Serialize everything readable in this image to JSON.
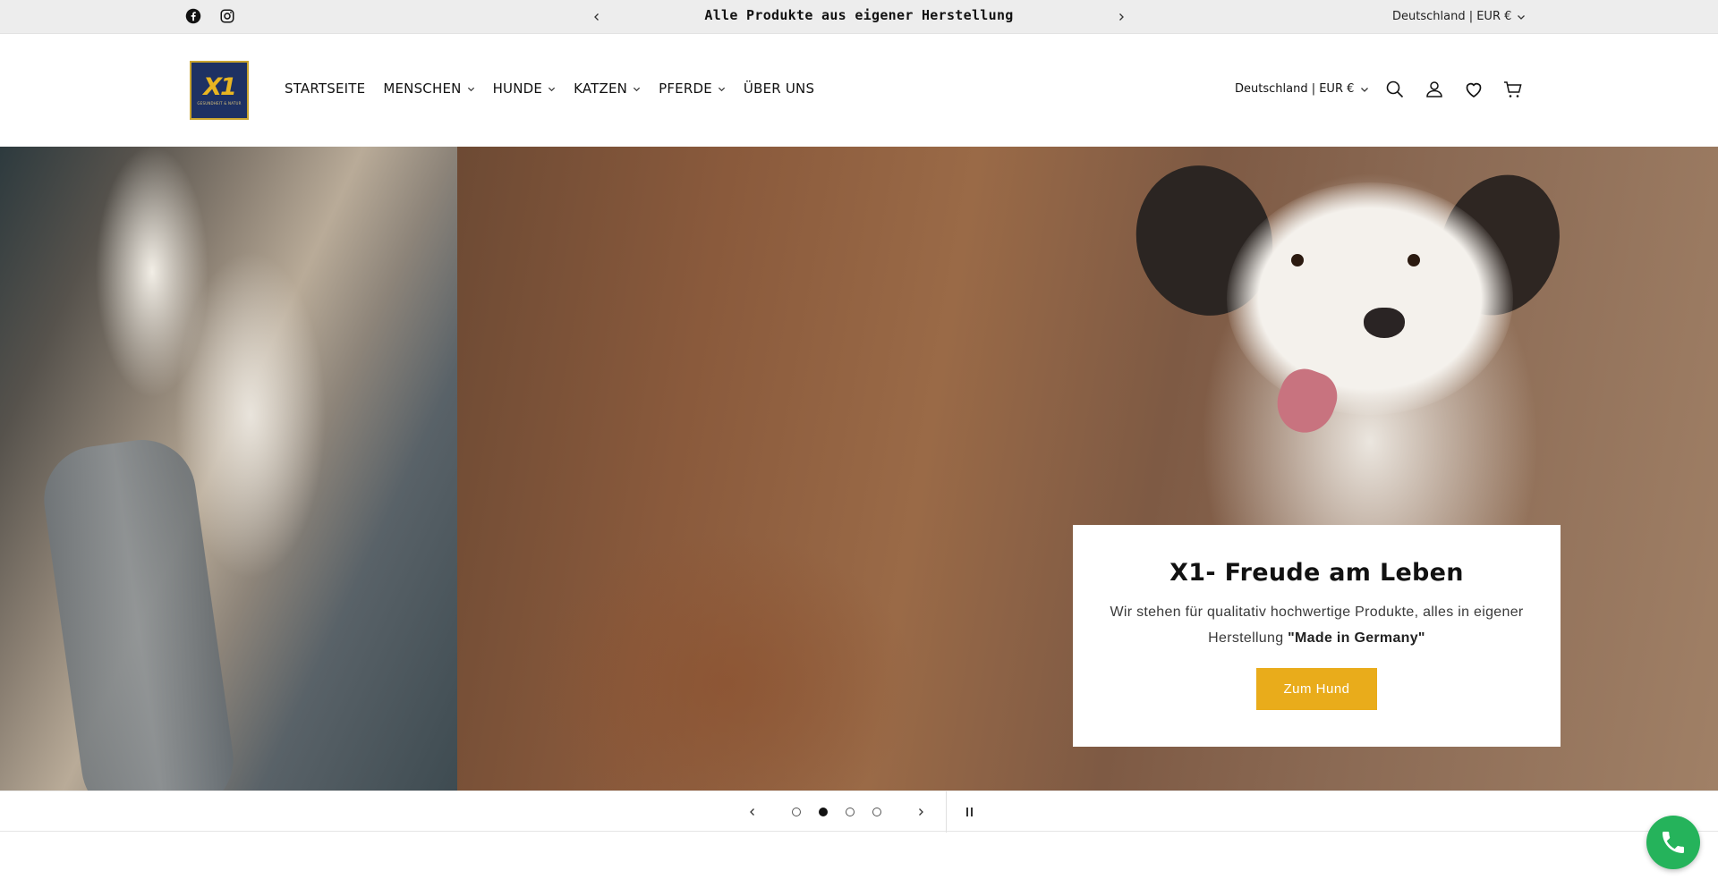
{
  "announcement": {
    "text": "Alle Produkte aus eigener Herstellung",
    "locale": "Deutschland | EUR €",
    "social_icons": [
      "facebook-icon",
      "instagram-icon"
    ]
  },
  "header": {
    "logo_text": "X1",
    "logo_subtext": "GESUNDHEIT & NATUR",
    "nav": [
      {
        "label": "STARTSEITE",
        "has_dropdown": false
      },
      {
        "label": "MENSCHEN",
        "has_dropdown": true
      },
      {
        "label": "HUNDE",
        "has_dropdown": true
      },
      {
        "label": "KATZEN",
        "has_dropdown": true
      },
      {
        "label": "PFERDE",
        "has_dropdown": true
      },
      {
        "label": "ÜBER UNS",
        "has_dropdown": false
      }
    ],
    "locale": "Deutschland | EUR €",
    "icons": [
      "search-icon",
      "account-icon",
      "wishlist-heart-icon",
      "cart-icon"
    ]
  },
  "hero": {
    "title": "X1- Freude am Leben",
    "text_before": "Wir stehen für qualitativ hochwertige Produkte, alles in eigener Herstellung ",
    "text_bold": "\"Made in Germany\"",
    "button_label": "Zum Hund"
  },
  "slider": {
    "slide_count": 4,
    "active_slide": 2
  },
  "colors": {
    "button": "#e9ac1b",
    "announcement_bg": "#ededed",
    "phone_fab": "#25b35b",
    "logo_bg": "#1e3163",
    "logo_accent": "#e9b521"
  }
}
